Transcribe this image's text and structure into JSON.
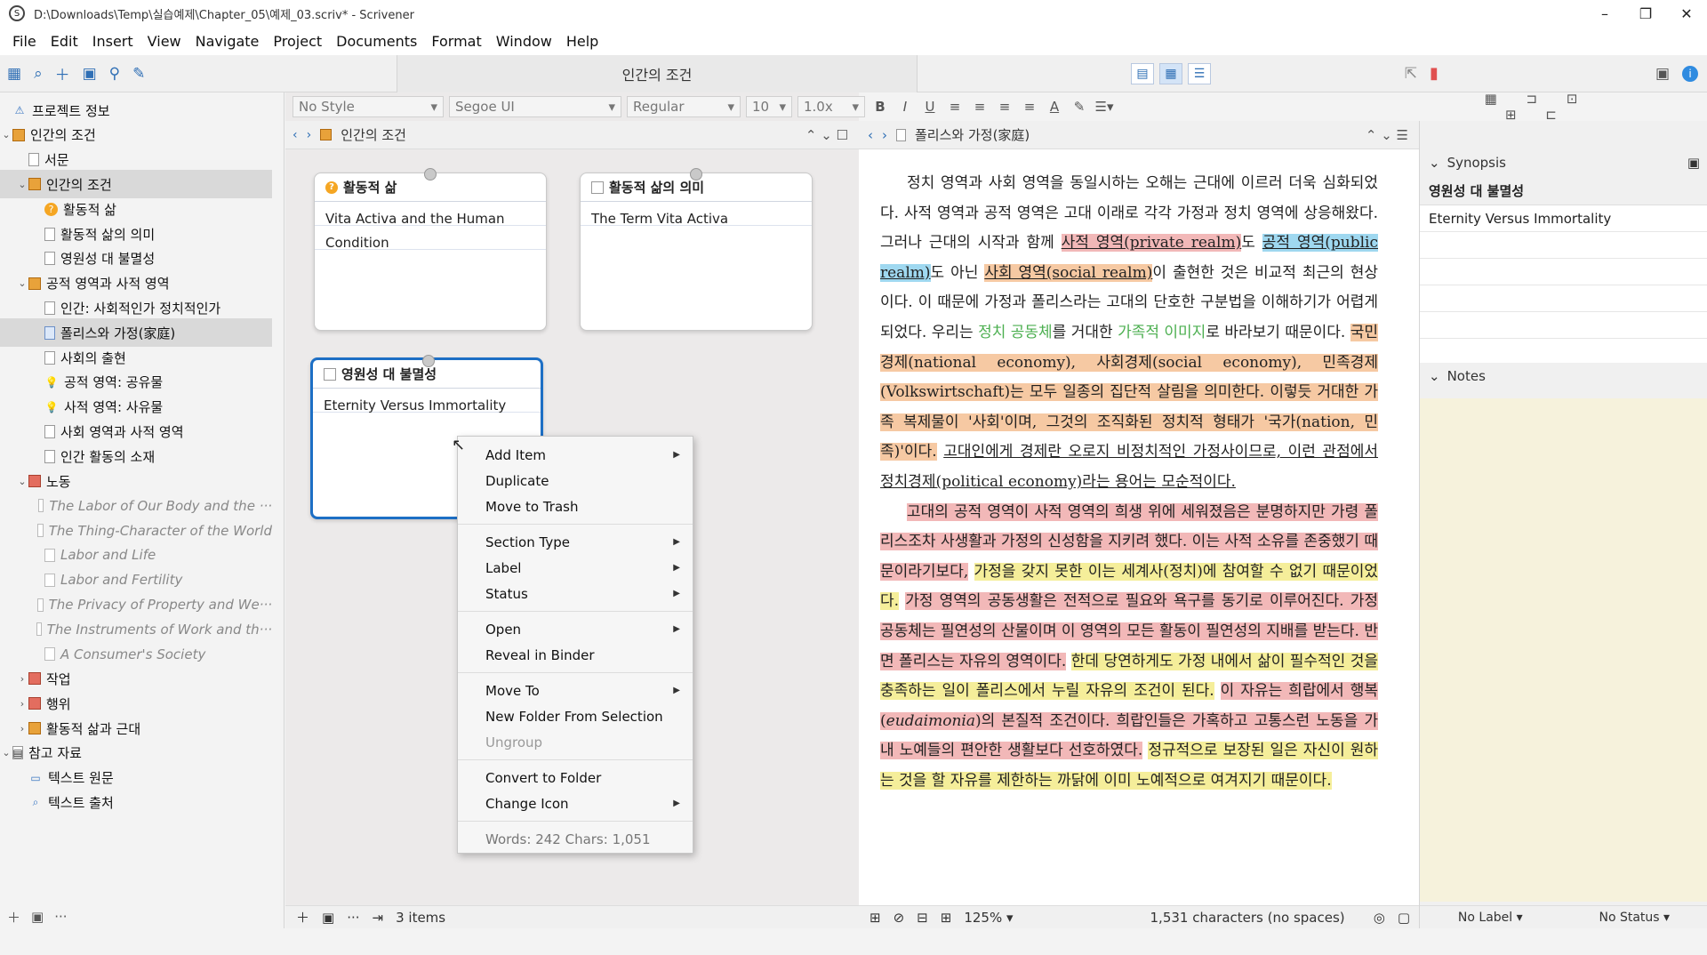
{
  "window": {
    "title": "D:\\Downloads\\Temp\\실습예제\\Chapter_05\\예제_03.scriv* - Scrivener",
    "minimize": "–",
    "maximize": "❐",
    "close": "✕"
  },
  "menu": [
    "File",
    "Edit",
    "Insert",
    "View",
    "Navigate",
    "Project",
    "Documents",
    "Format",
    "Window",
    "Help"
  ],
  "toolbar": {
    "doc_title": "인간의 조건"
  },
  "format_bar": {
    "style": "No Style",
    "font": "Segoe UI",
    "weight": "Regular",
    "size": "10",
    "spacing": "1.0x",
    "bold": "B",
    "italic": "I",
    "underline": "U"
  },
  "binder": {
    "items": [
      {
        "label": "프로젝트 정보",
        "icon": "project-icon",
        "level": 0,
        "arrow": ""
      },
      {
        "label": "인간의 조건",
        "icon": "folder",
        "level": 0,
        "arrow": "v"
      },
      {
        "label": "서문",
        "icon": "doc",
        "level": 1,
        "arrow": ""
      },
      {
        "label": "인간의 조건",
        "icon": "folder",
        "level": 1,
        "arrow": "v",
        "selected": true
      },
      {
        "label": "활동적 삶",
        "icon": "question",
        "level": 2,
        "arrow": ""
      },
      {
        "label": "활동적 삶의 의미",
        "icon": "doc",
        "level": 2,
        "arrow": ""
      },
      {
        "label": "영원성 대 불멸성",
        "icon": "doc",
        "level": 2,
        "arrow": ""
      },
      {
        "label": "공적 영역과 사적 영역",
        "icon": "folder",
        "level": 1,
        "arrow": "v"
      },
      {
        "label": "인간: 사회적인가 정치적인가",
        "icon": "doc",
        "level": 2,
        "arrow": ""
      },
      {
        "label": "폴리스와 가정(家庭)",
        "icon": "doc-blue",
        "level": 2,
        "arrow": "",
        "selected": true
      },
      {
        "label": "사회의 출현",
        "icon": "doc",
        "level": 2,
        "arrow": ""
      },
      {
        "label": "공적 영역: 공유물",
        "icon": "bulb",
        "level": 2,
        "arrow": ""
      },
      {
        "label": "사적 영역: 사유물",
        "icon": "bulb",
        "level": 2,
        "arrow": ""
      },
      {
        "label": "사회 영역과 사적 영역",
        "icon": "doc",
        "level": 2,
        "arrow": ""
      },
      {
        "label": "인간 활동의 소재",
        "icon": "doc",
        "level": 2,
        "arrow": ""
      },
      {
        "label": "노동",
        "icon": "folder-red",
        "level": 1,
        "arrow": "v"
      },
      {
        "label": "The Labor of Our Body and the ···",
        "icon": "gray",
        "level": 2,
        "arrow": "",
        "italic": true
      },
      {
        "label": "The Thing-Character of the World",
        "icon": "gray",
        "level": 2,
        "arrow": "",
        "italic": true
      },
      {
        "label": "Labor and Life",
        "icon": "gray",
        "level": 2,
        "arrow": "",
        "italic": true
      },
      {
        "label": "Labor and Fertility",
        "icon": "gray",
        "level": 2,
        "arrow": "",
        "italic": true
      },
      {
        "label": "The Privacy of Property and We···",
        "icon": "gray",
        "level": 2,
        "arrow": "",
        "italic": true
      },
      {
        "label": "The Instruments of Work and th···",
        "icon": "gray",
        "level": 2,
        "arrow": "",
        "italic": true
      },
      {
        "label": "A Consumer's Society",
        "icon": "gray",
        "level": 2,
        "arrow": "",
        "italic": true
      },
      {
        "label": "작업",
        "icon": "folder-red",
        "level": 1,
        "arrow": ">"
      },
      {
        "label": "행위",
        "icon": "folder-red",
        "level": 1,
        "arrow": ">"
      },
      {
        "label": "활동적 삶과 근대",
        "icon": "folder",
        "level": 1,
        "arrow": ">"
      },
      {
        "label": "참고 자료",
        "icon": "folder-gray",
        "level": 0,
        "arrow": "v"
      },
      {
        "label": "텍스트 원문",
        "icon": "text",
        "level": 1,
        "arrow": ""
      },
      {
        "label": "텍스트 출처",
        "icon": "search",
        "level": 1,
        "arrow": ""
      }
    ]
  },
  "corkboard": {
    "path": "인간의 조건",
    "cards": [
      {
        "title": "활동적 삶",
        "body": "Vita Activa and the Human Condition",
        "icon": "question"
      },
      {
        "title": "활동적 삶의 의미",
        "body": "The Term Vita Activa",
        "icon": "doc"
      },
      {
        "title": "영원성 대 불멸성",
        "body": "Eternity Versus Immortality",
        "icon": "doc"
      }
    ],
    "footer": "3 items"
  },
  "context_menu": {
    "items": [
      {
        "label": "Add Item",
        "sub": true
      },
      {
        "label": "Duplicate"
      },
      {
        "label": "Move to Trash"
      },
      {
        "sep": true
      },
      {
        "label": "Section Type",
        "sub": true
      },
      {
        "label": "Label",
        "sub": true
      },
      {
        "label": "Status",
        "sub": true
      },
      {
        "sep": true
      },
      {
        "label": "Open",
        "sub": true
      },
      {
        "label": "Reveal in Binder"
      },
      {
        "sep": true
      },
      {
        "label": "Move To",
        "sub": true
      },
      {
        "label": "New Folder From Selection"
      },
      {
        "label": "Ungroup",
        "disabled": true
      },
      {
        "sep": true
      },
      {
        "label": "Convert to Folder"
      },
      {
        "label": "Change Icon",
        "sub": true
      },
      {
        "sep": true
      },
      {
        "label": "Words: 242   Chars: 1,051",
        "words": true
      }
    ]
  },
  "editor": {
    "header": "폴리스와 가정(家庭)",
    "zoom": "125%",
    "status": "1,531 characters (no spaces)"
  },
  "inspector": {
    "synopsis_label": "Synopsis",
    "synopsis_title": "영원성 대 불멸성",
    "synopsis_text": "Eternity Versus Immortality",
    "notes_label": "Notes",
    "label": "No Label",
    "status": "No Status"
  },
  "colors": {
    "accent": "#1d6fc5",
    "orange_highlight": "#f6c9a3",
    "pink_highlight": "#f2b8b8",
    "yellow_highlight": "#f5ee9a",
    "blue_highlight": "#9fd8f0"
  }
}
